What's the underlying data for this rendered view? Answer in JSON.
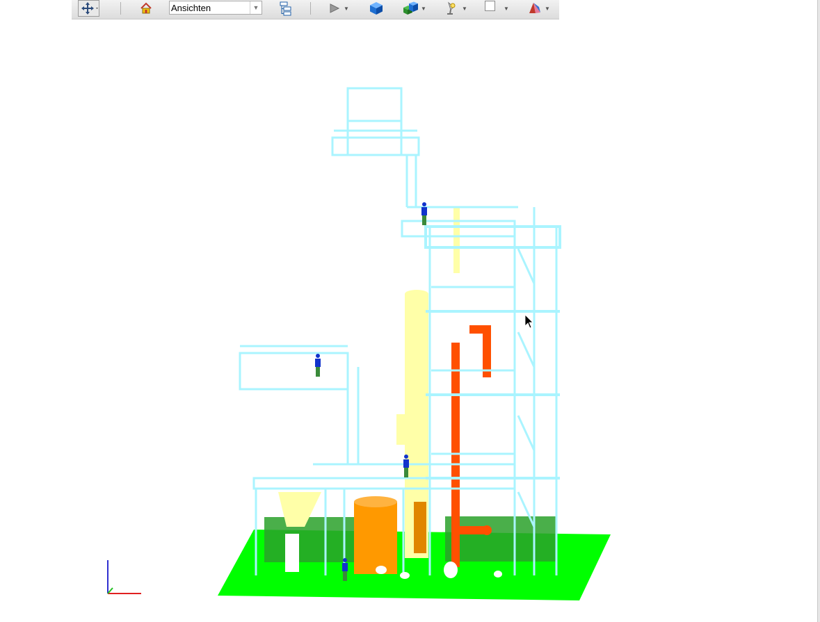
{
  "toolbar": {
    "navigate_icon": "navigate-cross-icon",
    "home_icon": "home-icon",
    "views_combo": {
      "selected": "Ansichten"
    },
    "tree_icon": "model-tree-icon",
    "play_icon": "play-icon",
    "cube_icon": "solid-cube-icon",
    "shading_icon": "shading-boxes-icon",
    "light_icon": "lamp-icon",
    "page_icon": "blank-page-icon",
    "section_icon": "section-wedge-icon"
  },
  "viewport": {
    "ground_color": "#00ff00",
    "structure_color": "#aaf4ff",
    "column_color": "#ffffa8",
    "vessel_color": "#ff9900",
    "pipe_color": "#ff5000",
    "axis_triad": [
      "x-axis",
      "y-axis",
      "z-axis"
    ]
  }
}
